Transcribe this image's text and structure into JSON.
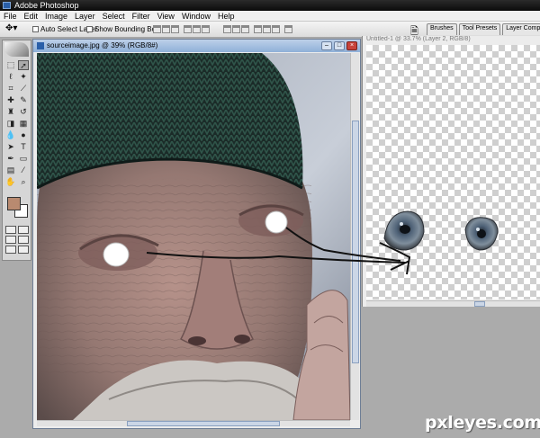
{
  "app": {
    "title": "Adobe Photoshop"
  },
  "menu": [
    "File",
    "Edit",
    "Image",
    "Layer",
    "Select",
    "Filter",
    "View",
    "Window",
    "Help"
  ],
  "options": {
    "auto_select_label": "Auto Select Layer",
    "bounding_box_label": "Show Bounding Box"
  },
  "panel_tabs": [
    "Brushes",
    "Tool Presets",
    "Layer Comps"
  ],
  "source_window": {
    "title": "sourceimage.jpg @ 39% (RGB/8#)"
  },
  "canvas_window": {
    "title": "Untitled-1 @ 33.7% (Layer 2, RGB/8)"
  },
  "colors": {
    "foreground": "#b98a70",
    "background": "#ffffff",
    "accent": "#8fb0d8"
  },
  "icons": {
    "tools": [
      "marquee-icon",
      "move-icon",
      "lasso-icon",
      "magic-wand-icon",
      "crop-icon",
      "slice-icon",
      "healing-icon",
      "brush-icon",
      "stamp-icon",
      "history-brush-icon",
      "eraser-icon",
      "gradient-icon",
      "blur-icon",
      "dodge-icon",
      "path-select-icon",
      "type-icon",
      "pen-icon",
      "shape-icon",
      "notes-icon",
      "eyedropper-icon",
      "hand-icon",
      "zoom-icon"
    ]
  },
  "watermark": "pxleyes.com"
}
